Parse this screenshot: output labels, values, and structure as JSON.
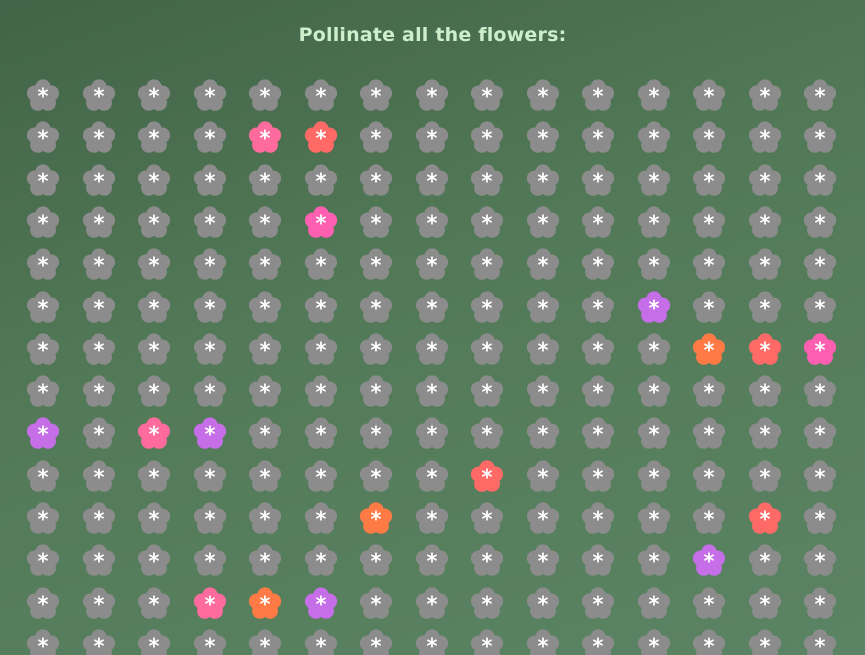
{
  "title": "Pollinate all the flowers:",
  "colors": {
    "unpollinated": "#8c8c8c",
    "pink": "#ff6b9c",
    "coral": "#ff6a66",
    "orange": "#ff7a45",
    "purple": "#c56ee8",
    "magenta": "#ff5fb0",
    "star": "#ffffff"
  },
  "grid": {
    "rows": 14,
    "cols": 15,
    "flower_icon": "flower-icon",
    "center_glyph": "*",
    "pollinated": [
      {
        "row": 1,
        "col": 4,
        "color": "pink"
      },
      {
        "row": 1,
        "col": 5,
        "color": "coral"
      },
      {
        "row": 3,
        "col": 5,
        "color": "magenta"
      },
      {
        "row": 5,
        "col": 11,
        "color": "purple"
      },
      {
        "row": 6,
        "col": 12,
        "color": "orange"
      },
      {
        "row": 6,
        "col": 13,
        "color": "coral"
      },
      {
        "row": 6,
        "col": 14,
        "color": "magenta"
      },
      {
        "row": 8,
        "col": 0,
        "color": "purple"
      },
      {
        "row": 8,
        "col": 2,
        "color": "pink"
      },
      {
        "row": 8,
        "col": 3,
        "color": "purple"
      },
      {
        "row": 9,
        "col": 8,
        "color": "coral"
      },
      {
        "row": 10,
        "col": 6,
        "color": "orange"
      },
      {
        "row": 10,
        "col": 13,
        "color": "coral"
      },
      {
        "row": 11,
        "col": 12,
        "color": "purple"
      },
      {
        "row": 12,
        "col": 3,
        "color": "pink"
      },
      {
        "row": 12,
        "col": 4,
        "color": "orange"
      },
      {
        "row": 12,
        "col": 5,
        "color": "purple"
      }
    ]
  }
}
